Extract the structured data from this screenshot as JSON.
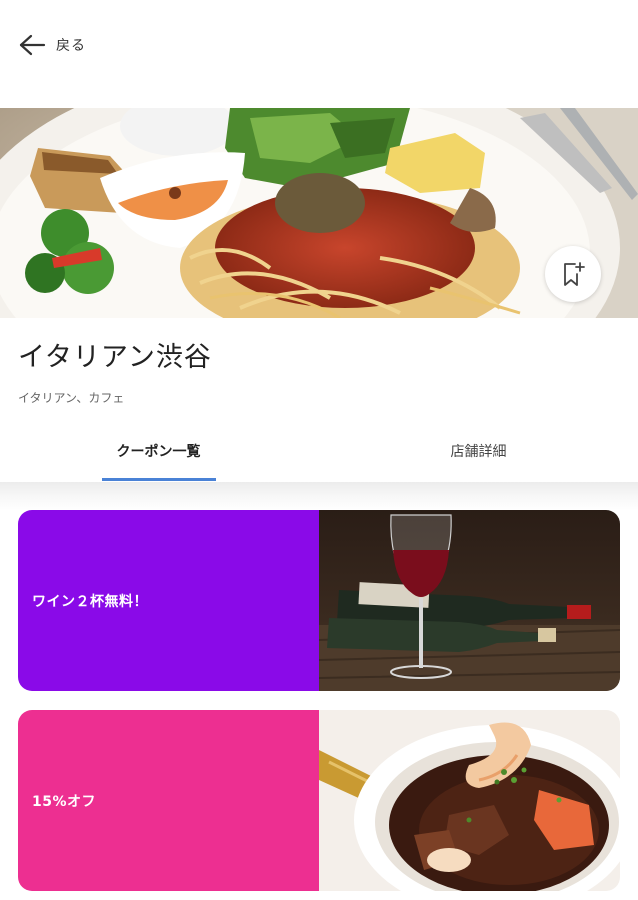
{
  "header": {
    "back_label": "戻る"
  },
  "restaurant": {
    "name": "イタリアン渋谷",
    "categories": "イタリアン、カフェ"
  },
  "tabs": [
    {
      "label": "クーポン一覧",
      "active": true
    },
    {
      "label": "店舗詳細",
      "active": false
    }
  ],
  "coupons": [
    {
      "label": "ワイン２杯無料！",
      "color": "#8a0ae8",
      "image": "wine-bottles-image"
    },
    {
      "label": "15%オフ",
      "color": "#ed2f91",
      "image": "stew-dish-image"
    }
  ],
  "colors": {
    "tab_accent": "#4a82d6"
  }
}
